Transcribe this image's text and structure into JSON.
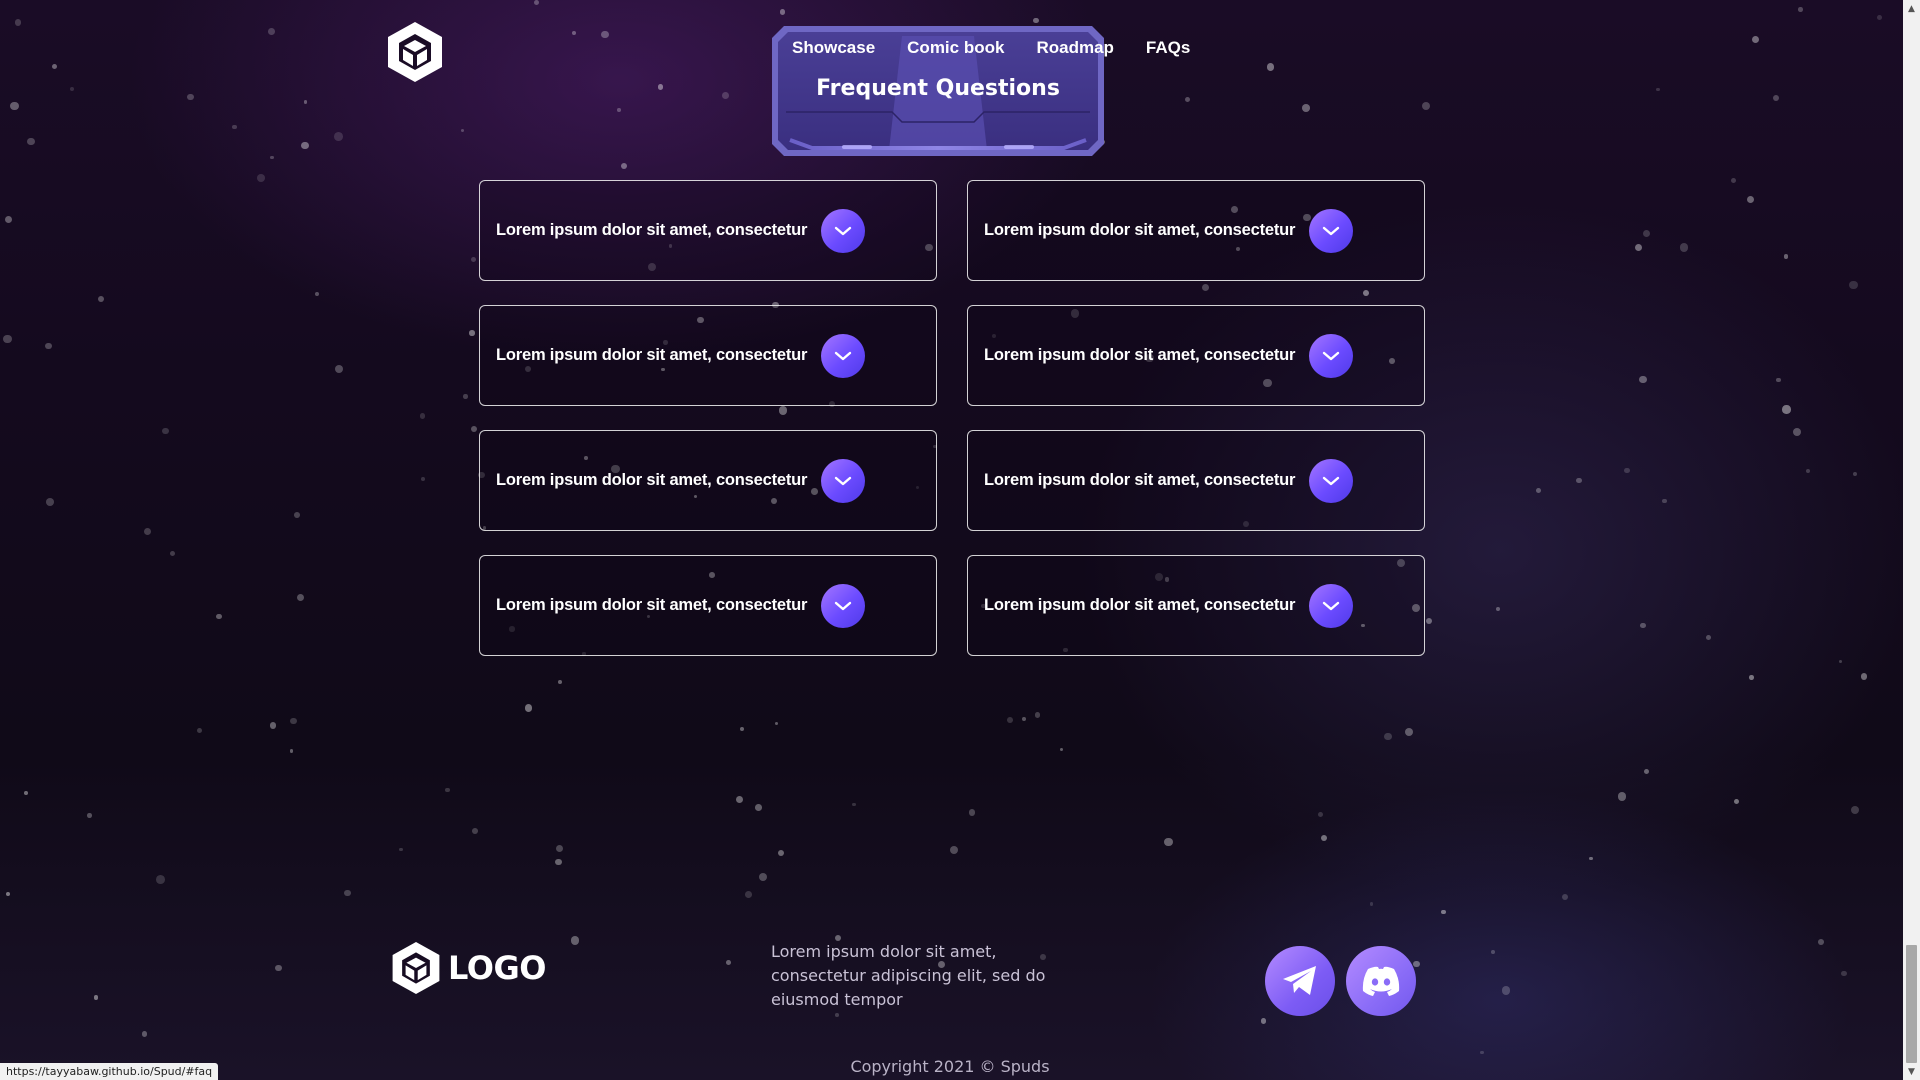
{
  "nav": {
    "items": [
      "Showcase",
      "Comic book",
      "Roadmap",
      "FAQs"
    ]
  },
  "faq": {
    "title": "Frequent Questions",
    "questions": [
      "Lorem ipsum dolor sit amet, consectetur",
      "Lorem ipsum dolor sit amet, consectetur",
      "Lorem ipsum dolor sit amet, consectetur",
      "Lorem ipsum dolor sit amet, consectetur",
      "Lorem ipsum dolor sit amet, consectetur",
      "Lorem ipsum dolor sit amet, consectetur",
      "Lorem ipsum dolor sit amet, consectetur",
      "Lorem ipsum dolor sit amet, consectetur"
    ]
  },
  "footer": {
    "logo_text": "LOGO",
    "description": "Lorem ipsum dolor sit amet, consectetur adipiscing elit, sed do eiusmod tempor",
    "copyright": "Copyright 2021 © Spuds",
    "social": [
      "telegram-icon",
      "discord-icon"
    ]
  },
  "status_bar": {
    "url": "https://tayyabaw.github.io/Spud/#faq"
  },
  "colors": {
    "accent": "#6b4bff",
    "accent_light": "#a476ff",
    "frame": "#5b4fb0"
  }
}
